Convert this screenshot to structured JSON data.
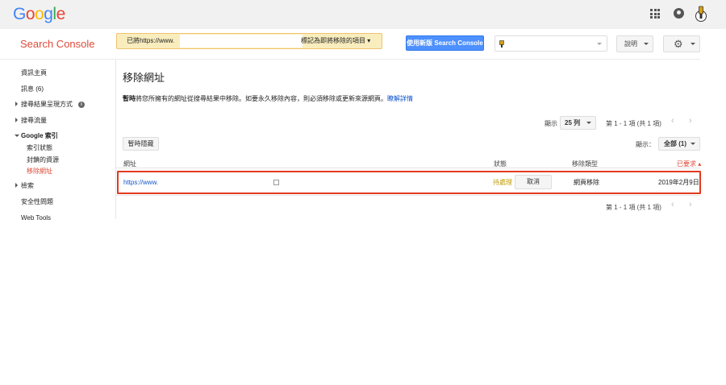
{
  "header": {
    "logo_letters": [
      {
        "ch": "G",
        "color": "#4285f4"
      },
      {
        "ch": "o",
        "color": "#ea4335"
      },
      {
        "ch": "o",
        "color": "#fbbc05"
      },
      {
        "ch": "g",
        "color": "#4285f4"
      },
      {
        "ch": "l",
        "color": "#34a853"
      },
      {
        "ch": "e",
        "color": "#ea4335"
      }
    ],
    "product": "Search Console",
    "notice": {
      "prefix": "已將",
      "url": "https://www.",
      "suffix": "標記為即將移除的項目 ▾"
    },
    "new_version_button": "使用新版 Search Console",
    "help_button": "說明",
    "settings_icon": "⚙"
  },
  "sidebar": {
    "items": [
      {
        "label": "資訊主頁"
      },
      {
        "label": "訊息 (6)"
      },
      {
        "label": "搜尋結果呈現方式"
      },
      {
        "label": "搜尋流量"
      },
      {
        "label": "Google 索引"
      },
      {
        "label": "索引狀態"
      },
      {
        "label": "封鎖的資源"
      },
      {
        "label": "移除網址"
      },
      {
        "label": "檢索"
      },
      {
        "label": "安全性問題"
      },
      {
        "label": "Web Tools"
      }
    ],
    "info_icon": "i"
  },
  "main": {
    "title": "移除網址",
    "description_bold": "暫時",
    "description": "將您所擁有的網址從搜尋結果中移除。如要永久移除內容，則必須移除或更新來源網頁。",
    "learn_more": "瞭解詳情",
    "pager": {
      "show_label": "顯示",
      "rows": "25 列",
      "range": "第 1 - 1 項 (共 1 項)",
      "prev": "‹",
      "next": "›"
    },
    "temp_hide_button": "暫時隱藏",
    "filter": {
      "label": "顯示：",
      "value": "全部 (1)"
    },
    "table": {
      "headers": {
        "url": "網址",
        "status": "狀態",
        "type": "移除類型",
        "requested": "已要求 ▴"
      },
      "rows": [
        {
          "url": "https://www.",
          "status": "待處理",
          "action": "取消",
          "type": "網頁移除",
          "date": "2019年2月9日"
        }
      ]
    }
  }
}
